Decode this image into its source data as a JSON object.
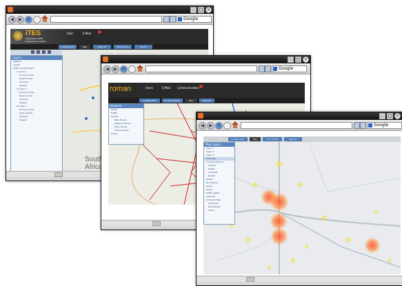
{
  "colors": {
    "accent_blue": "#4d7bb5",
    "header_dark": "#2a2a2a",
    "road_red": "#cc2222",
    "heat_red": "#ff5a3c",
    "heat_yellow": "#f2e23a"
  },
  "browser": {
    "search_engine": "Google"
  },
  "win1": {
    "app_name": "iTES",
    "app_subtitle_1": "Integrated Traffic",
    "app_subtitle_2": "Engineering System",
    "user_item_1": "User",
    "user_item_2": "E-Mail",
    "tabs": [
      "Configuration",
      "Map",
      "Reports",
      "Documents",
      "Admin"
    ],
    "panel_title": "Layers",
    "panel_items": [
      "Stations",
      "Assets",
      "Traffic Counter Data",
      "Counter 1",
      "Hourly Counts",
      "Daily Counts",
      "Volumes",
      "Speeds",
      "Counter 2",
      "Hourly Counts",
      "Daily Counts",
      "Volumes",
      "Speeds",
      "Counter 3",
      "Hourly Counts",
      "Daily Counts",
      "Volumes",
      "Speeds"
    ],
    "map_label_1": "South",
    "map_label_2": "Africa"
  },
  "win2": {
    "app_name": "roman",
    "user_items": [
      "Users",
      "E-Mail",
      "Communication"
    ],
    "tabs": [
      "Configuration",
      "Incident Report",
      "Map",
      "Reports"
    ],
    "panel_title": "Network",
    "panel_items": [
      "Roads",
      "Traffic",
      "Routes",
      "Main Roads",
      "Regional Roads",
      "Minor Roads",
      "District Roads",
      "Towns"
    ]
  },
  "win3": {
    "tabs": [
      "Configuration",
      "Map",
      "Documents",
      "Reports"
    ],
    "panel_title": "Map Layers",
    "panel_items": [
      "Layer 1",
      "Layer 2",
      "Layer 3",
      "Heat Map",
      "Counter Stations",
      "Volume",
      "Speed",
      "Incidents",
      "Events",
      "Roads",
      "Boundaries",
      "Areas",
      "Zones",
      "Traffic Lights",
      "Cameras",
      "Incidents Map",
      "Accidents",
      "Road Works",
      "Towns"
    ]
  }
}
